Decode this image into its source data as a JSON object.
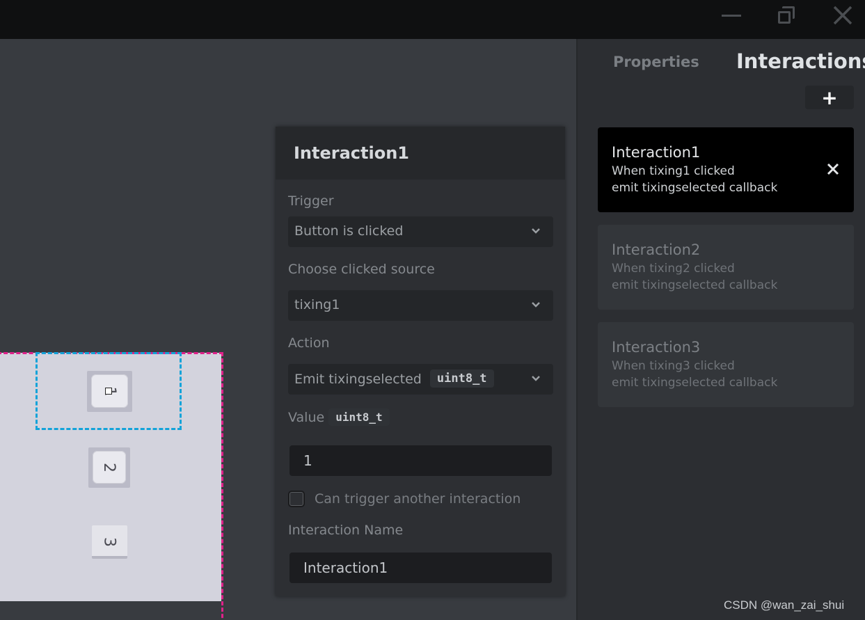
{
  "window": {
    "minimize_icon": "minimize-icon",
    "restore_icon": "restore-icon",
    "close_icon": "close-icon"
  },
  "canvas": {
    "tiles": [
      {
        "label": "1"
      },
      {
        "label": "2"
      },
      {
        "label": "3"
      }
    ],
    "colors": {
      "screen_border": "#e0218a",
      "selection_border": "#12a3d9"
    }
  },
  "editor": {
    "title": "Interaction1",
    "trigger_label": "Trigger",
    "trigger_value": "Button is clicked",
    "source_label": "Choose clicked source",
    "source_value": "tixing1",
    "action_label": "Action",
    "action_value": "Emit tixingselected",
    "action_type": "uint8_t",
    "value_label": "Value",
    "value_type": "uint8_t",
    "value_input": "1",
    "can_trigger_label": "Can trigger another interaction",
    "can_trigger_checked": false,
    "name_label": "Interaction Name",
    "name_value": "Interaction1"
  },
  "panel": {
    "tabs": {
      "properties": "Properties",
      "interactions": "Interactions"
    },
    "active_tab": "Interactions",
    "add_label": "+",
    "interactions": [
      {
        "title": "Interaction1",
        "line1": "When tixing1 clicked",
        "line2": "emit tixingselected callback",
        "active": true
      },
      {
        "title": "Interaction2",
        "line1": "When tixing2 clicked",
        "line2": "emit tixingselected callback",
        "active": false
      },
      {
        "title": "Interaction3",
        "line1": "When tixing3 clicked",
        "line2": "emit tixingselected callback",
        "active": false
      }
    ]
  },
  "watermark": "CSDN @wan_zai_shui"
}
